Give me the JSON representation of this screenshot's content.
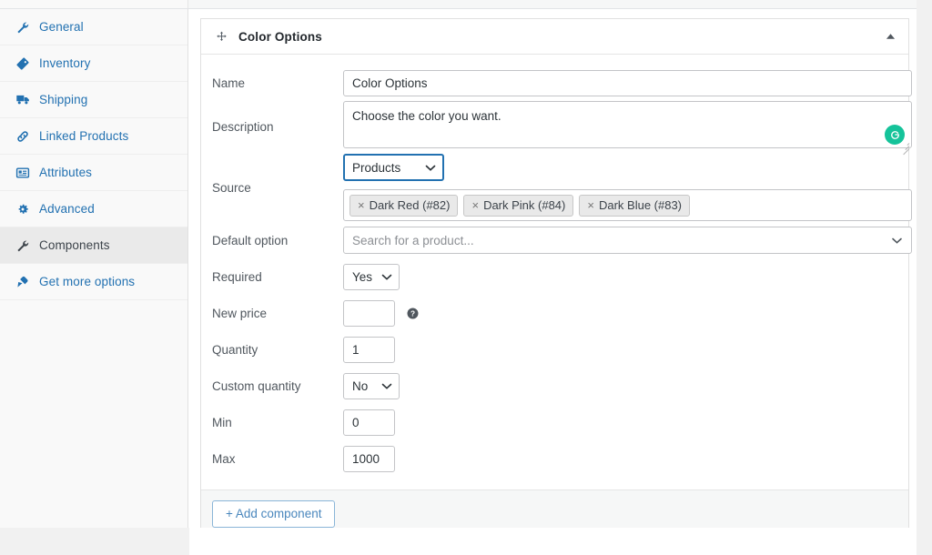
{
  "sidebar": {
    "items": [
      {
        "label": "General",
        "icon": "wrench-icon",
        "active": false
      },
      {
        "label": "Inventory",
        "icon": "tag-icon",
        "active": false
      },
      {
        "label": "Shipping",
        "icon": "truck-icon",
        "active": false
      },
      {
        "label": "Linked Products",
        "icon": "link-icon",
        "active": false
      },
      {
        "label": "Attributes",
        "icon": "list-view-icon",
        "active": false
      },
      {
        "label": "Advanced",
        "icon": "gear-icon",
        "active": false
      },
      {
        "label": "Components",
        "icon": "wrench-icon",
        "active": true
      },
      {
        "label": "Get more options",
        "icon": "plugin-icon",
        "active": false
      }
    ]
  },
  "panel": {
    "title": "Color Options",
    "move_handle": "move-handle-icon",
    "collapse_toggle": "caret-up-icon",
    "fields": {
      "name": {
        "label": "Name",
        "value": "Color Options",
        "placeholder": ""
      },
      "description": {
        "label": "Description",
        "value": "Choose the color you want.",
        "placeholder": "",
        "assistant_icon": "grammarly-icon",
        "assistant_letter": "G"
      },
      "source": {
        "label": "Source",
        "selected": "Products",
        "tokens": [
          {
            "remove": "×",
            "label": "Dark Red (#82)"
          },
          {
            "remove": "×",
            "label": "Dark Pink (#84)"
          },
          {
            "remove": "×",
            "label": "Dark Blue (#83)"
          }
        ]
      },
      "default_option": {
        "label": "Default option",
        "placeholder": "Search for a product...",
        "value": ""
      },
      "required": {
        "label": "Required",
        "selected": "Yes"
      },
      "new_price": {
        "label": "New price",
        "value": "",
        "placeholder": "",
        "help_icon": "help-icon"
      },
      "quantity": {
        "label": "Quantity",
        "value": "1",
        "placeholder": ""
      },
      "custom_quantity": {
        "label": "Custom quantity",
        "selected": "No"
      },
      "min": {
        "label": "Min",
        "value": "0",
        "placeholder": ""
      },
      "max": {
        "label": "Max",
        "value": "1000",
        "placeholder": ""
      }
    },
    "footer": {
      "add_component_label": "+ Add component"
    }
  },
  "colors": {
    "link": "#2271b1",
    "active_tab_bg": "#eaeaea",
    "focus_border": "#2271b1",
    "grammarly_green": "#15c39a",
    "footer_bg": "#f6f7f7",
    "button_text": "#4a87bd"
  }
}
